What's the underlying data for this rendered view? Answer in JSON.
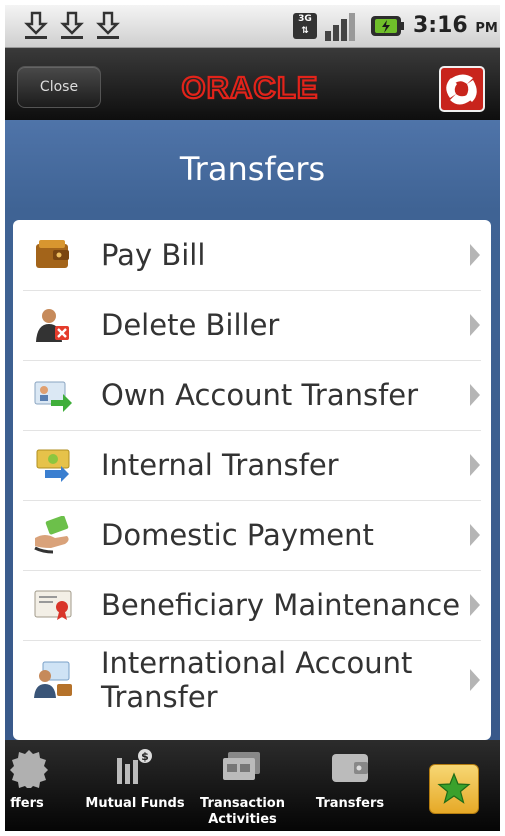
{
  "status_bar": {
    "network": "3G",
    "time": "3:16",
    "ampm": "PM"
  },
  "header": {
    "close_label": "Close",
    "brand": "ORACLE"
  },
  "page": {
    "title": "Transfers"
  },
  "menu": {
    "items": [
      {
        "label": "Pay Bill",
        "icon": "wallet-icon"
      },
      {
        "label": "Delete Biller",
        "icon": "delete-biller-icon"
      },
      {
        "label": "Own Account Transfer",
        "icon": "own-account-transfer-icon"
      },
      {
        "label": "Internal Transfer",
        "icon": "internal-transfer-icon"
      },
      {
        "label": "Domestic Payment",
        "icon": "domestic-payment-icon"
      },
      {
        "label": "Beneficiary Maintenance",
        "icon": "certificate-icon"
      },
      {
        "label": "International Account Transfer",
        "icon": "international-transfer-icon"
      }
    ]
  },
  "bottom_nav": {
    "items": [
      {
        "label": "ffers"
      },
      {
        "label": "Mutual Funds"
      },
      {
        "label": "Transaction Activities"
      },
      {
        "label": "Transfers"
      }
    ]
  },
  "colors": {
    "accent_blue": "#4a6fa5",
    "oracle_red": "#e2231a",
    "fav_gold": "#f0b830"
  }
}
